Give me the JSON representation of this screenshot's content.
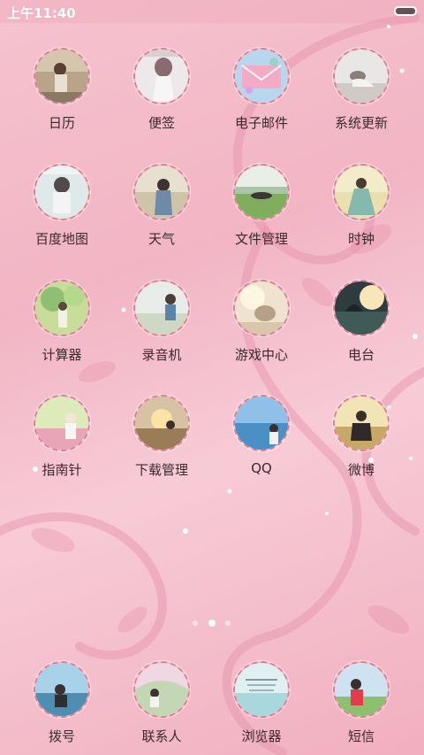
{
  "status_bar": {
    "time": "上午11:40",
    "battery_icon": "battery-icon"
  },
  "apps": [
    {
      "label": "日历",
      "icon": "calendar-icon"
    },
    {
      "label": "便签",
      "icon": "notes-icon"
    },
    {
      "label": "电子邮件",
      "icon": "email-icon"
    },
    {
      "label": "系统更新",
      "icon": "system-update-icon"
    },
    {
      "label": "百度地图",
      "icon": "baidu-map-icon"
    },
    {
      "label": "天气",
      "icon": "weather-icon"
    },
    {
      "label": "文件管理",
      "icon": "file-manager-icon"
    },
    {
      "label": "时钟",
      "icon": "clock-icon"
    },
    {
      "label": "计算器",
      "icon": "calculator-icon"
    },
    {
      "label": "录音机",
      "icon": "recorder-icon"
    },
    {
      "label": "游戏中心",
      "icon": "game-center-icon"
    },
    {
      "label": "电台",
      "icon": "radio-icon"
    },
    {
      "label": "指南针",
      "icon": "compass-icon"
    },
    {
      "label": "下载管理",
      "icon": "download-manager-icon"
    },
    {
      "label": "QQ",
      "icon": "qq-icon"
    },
    {
      "label": "微博",
      "icon": "weibo-icon"
    }
  ],
  "dock": [
    {
      "label": "拨号",
      "icon": "dialer-icon"
    },
    {
      "label": "联系人",
      "icon": "contacts-icon"
    },
    {
      "label": "浏览器",
      "icon": "browser-icon"
    },
    {
      "label": "短信",
      "icon": "messages-icon"
    }
  ],
  "page_indicator": {
    "pages": 3,
    "current": 2
  },
  "colors": {
    "wallpaper": "#f4bcc9",
    "icon_ring": "#e07e8f",
    "label_text": "#3a2a2e"
  }
}
